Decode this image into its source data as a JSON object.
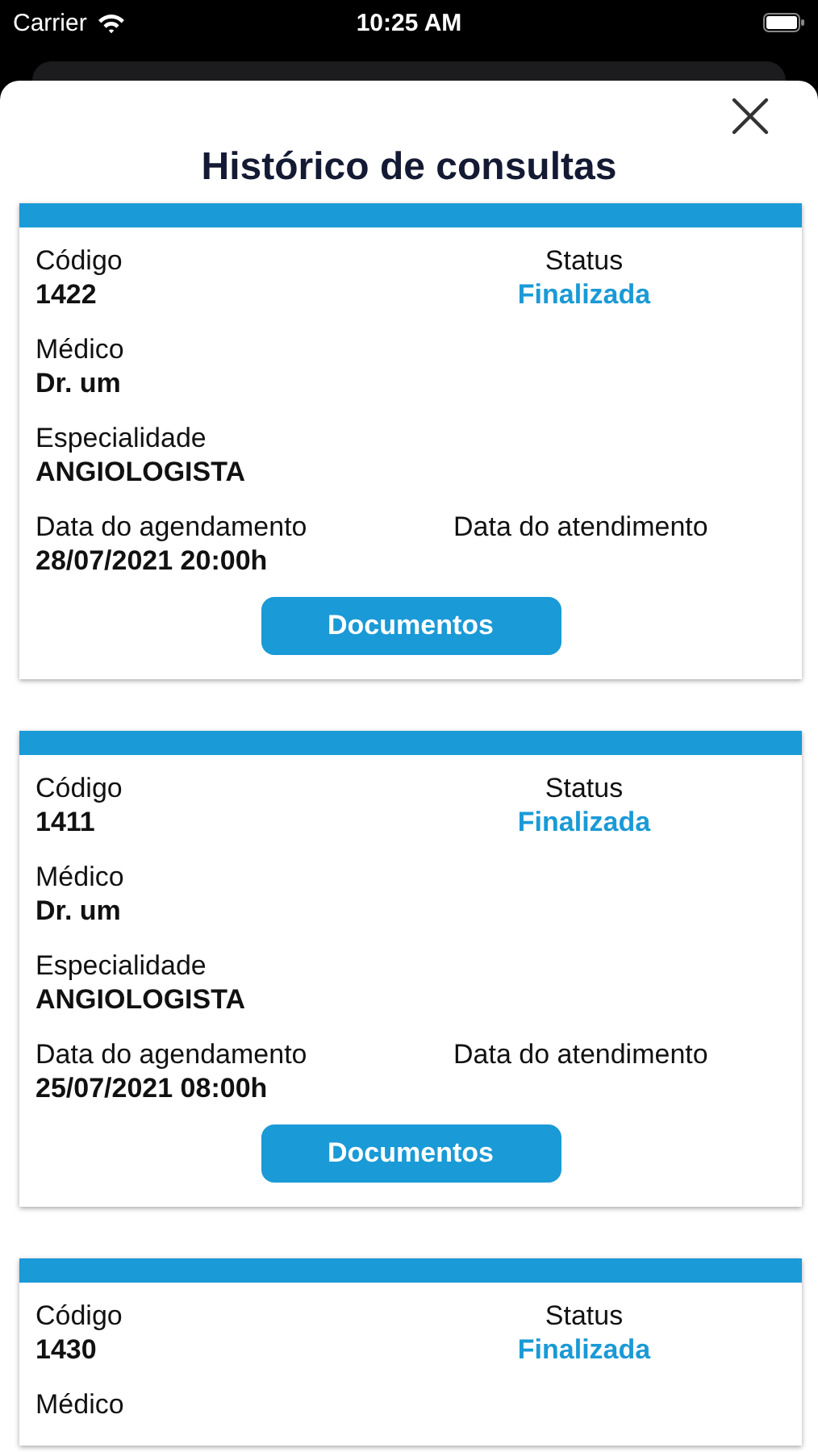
{
  "status_bar": {
    "carrier": "Carrier",
    "time": "10:25 AM"
  },
  "title": "Histórico de consultas",
  "cards": [
    {
      "code_label": "Código",
      "code": "1422",
      "status_label": "Status",
      "status": "Finalizada",
      "doctor_label": "Médico",
      "doctor": "Dr. um",
      "specialty_label": "Especialidade",
      "specialty": "ANGIOLOGISTA",
      "scheduled_label": "Data do agendamento",
      "scheduled": "28/07/2021 20:00h",
      "attended_label": "Data do atendimento",
      "button": "Documentos"
    },
    {
      "code_label": "Código",
      "code": "1411",
      "status_label": "Status",
      "status": "Finalizada",
      "doctor_label": "Médico",
      "doctor": "Dr. um",
      "specialty_label": "Especialidade",
      "specialty": "ANGIOLOGISTA",
      "scheduled_label": "Data do agendamento",
      "scheduled": "25/07/2021 08:00h",
      "attended_label": "Data do atendimento",
      "button": "Documentos"
    },
    {
      "code_label": "Código",
      "code": "1430",
      "status_label": "Status",
      "status": "Finalizada",
      "doctor_label": "Médico"
    }
  ]
}
